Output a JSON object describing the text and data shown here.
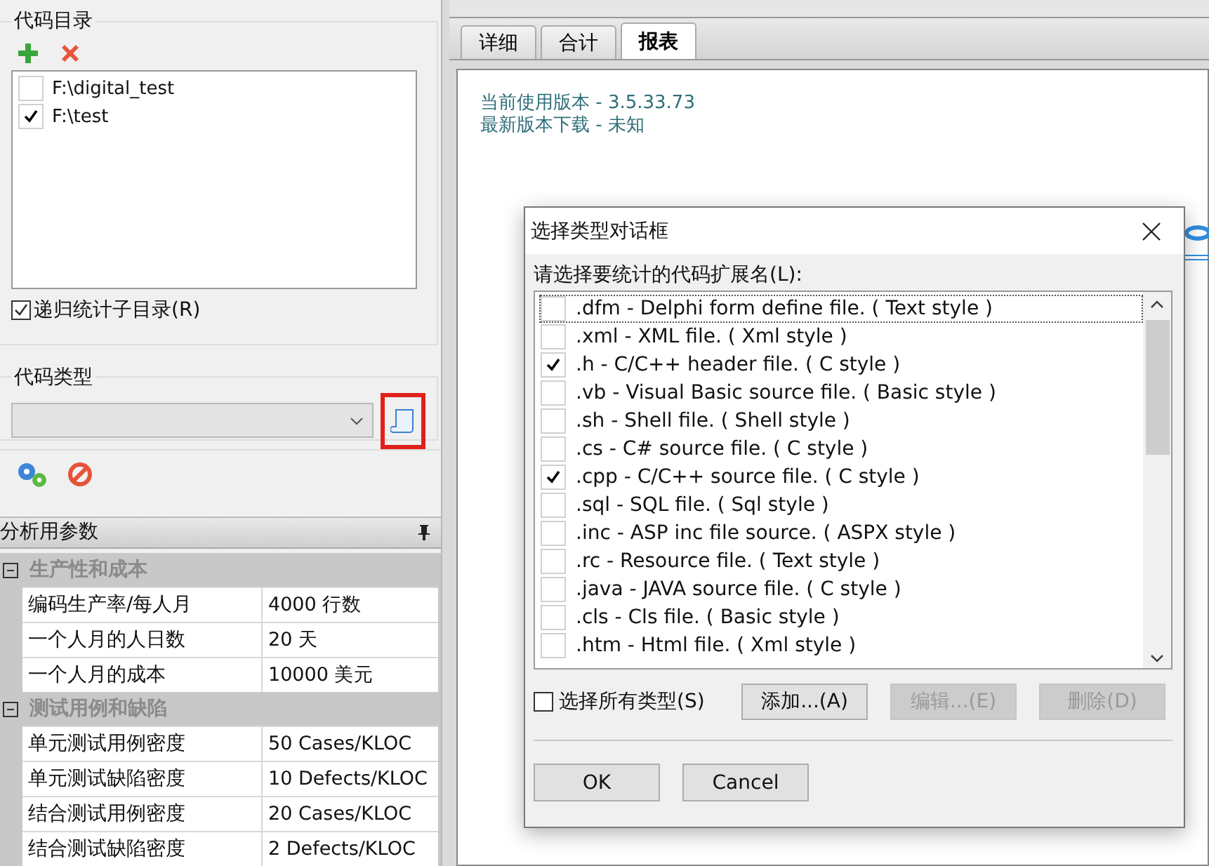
{
  "left_panel": {
    "code_dirs": {
      "title": "代码目录",
      "items": [
        {
          "path": "F:\\digital_test",
          "checked": false
        },
        {
          "path": "F:\\test",
          "checked": true
        }
      ],
      "recursive": {
        "label": "递归统计子目录(R)",
        "checked": true
      }
    },
    "code_type": {
      "title": "代码类型"
    },
    "params": {
      "title": "分析用参数",
      "groups": [
        {
          "title": "生产性和成本",
          "expanded": true,
          "rows": [
            {
              "name": "编码生产率/每人月",
              "value": "4000 行数"
            },
            {
              "name": "一个人月的人日数",
              "value": "20 天"
            },
            {
              "name": "一个人月的成本",
              "value": "10000 美元"
            }
          ]
        },
        {
          "title": "测试用例和缺陷",
          "expanded": true,
          "rows": [
            {
              "name": "单元测试用例密度",
              "value": "50 Cases/KLOC"
            },
            {
              "name": "单元测试缺陷密度",
              "value": "10 Defects/KLOC"
            },
            {
              "name": "结合测试用例密度",
              "value": "20 Cases/KLOC"
            },
            {
              "name": "结合测试缺陷密度",
              "value": "2 Defects/KLOC"
            }
          ]
        }
      ]
    }
  },
  "results": {
    "tabs": [
      {
        "label": "详细",
        "selected": false
      },
      {
        "label": "合计",
        "selected": false
      },
      {
        "label": "报表",
        "selected": true
      }
    ],
    "lines": [
      "当前使用版本 - 3.5.33.73",
      "最新版本下载 - 未知"
    ]
  },
  "dialog": {
    "title": "选择类型对话框",
    "prompt": "请选择要统计的代码扩展名(L):",
    "items": [
      {
        "label": ".dfm - Delphi form define file. ( Text style )",
        "checked": false,
        "selected": true
      },
      {
        "label": ".xml - XML file. ( Xml style )",
        "checked": false,
        "selected": false
      },
      {
        "label": ".h - C/C++ header file. ( C style )",
        "checked": true,
        "selected": false
      },
      {
        "label": ".vb - Visual Basic source file. ( Basic style )",
        "checked": false,
        "selected": false
      },
      {
        "label": ".sh - Shell file. ( Shell style )",
        "checked": false,
        "selected": false
      },
      {
        "label": ".cs - C# source file. ( C style )",
        "checked": false,
        "selected": false
      },
      {
        "label": ".cpp - C/C++ source file. ( C style )",
        "checked": true,
        "selected": false
      },
      {
        "label": ".sql - SQL file. ( Sql style )",
        "checked": false,
        "selected": false
      },
      {
        "label": ".inc - ASP inc file source. ( ASPX style )",
        "checked": false,
        "selected": false
      },
      {
        "label": ".rc - Resource file. ( Text style )",
        "checked": false,
        "selected": false
      },
      {
        "label": ".java - JAVA source file. ( C style )",
        "checked": false,
        "selected": false
      },
      {
        "label": ".cls - Cls file. ( Basic style )",
        "checked": false,
        "selected": false
      },
      {
        "label": ".htm - Html file. ( Xml style )",
        "checked": false,
        "selected": false
      }
    ],
    "select_all": {
      "label": "选择所有类型(S)",
      "checked": false
    },
    "actions": [
      {
        "label": "添加...(A)",
        "disabled": false
      },
      {
        "label": "编辑...(E)",
        "disabled": true
      },
      {
        "label": "删除(D)",
        "disabled": true
      }
    ],
    "buttons": [
      "OK",
      "Cancel"
    ]
  }
}
